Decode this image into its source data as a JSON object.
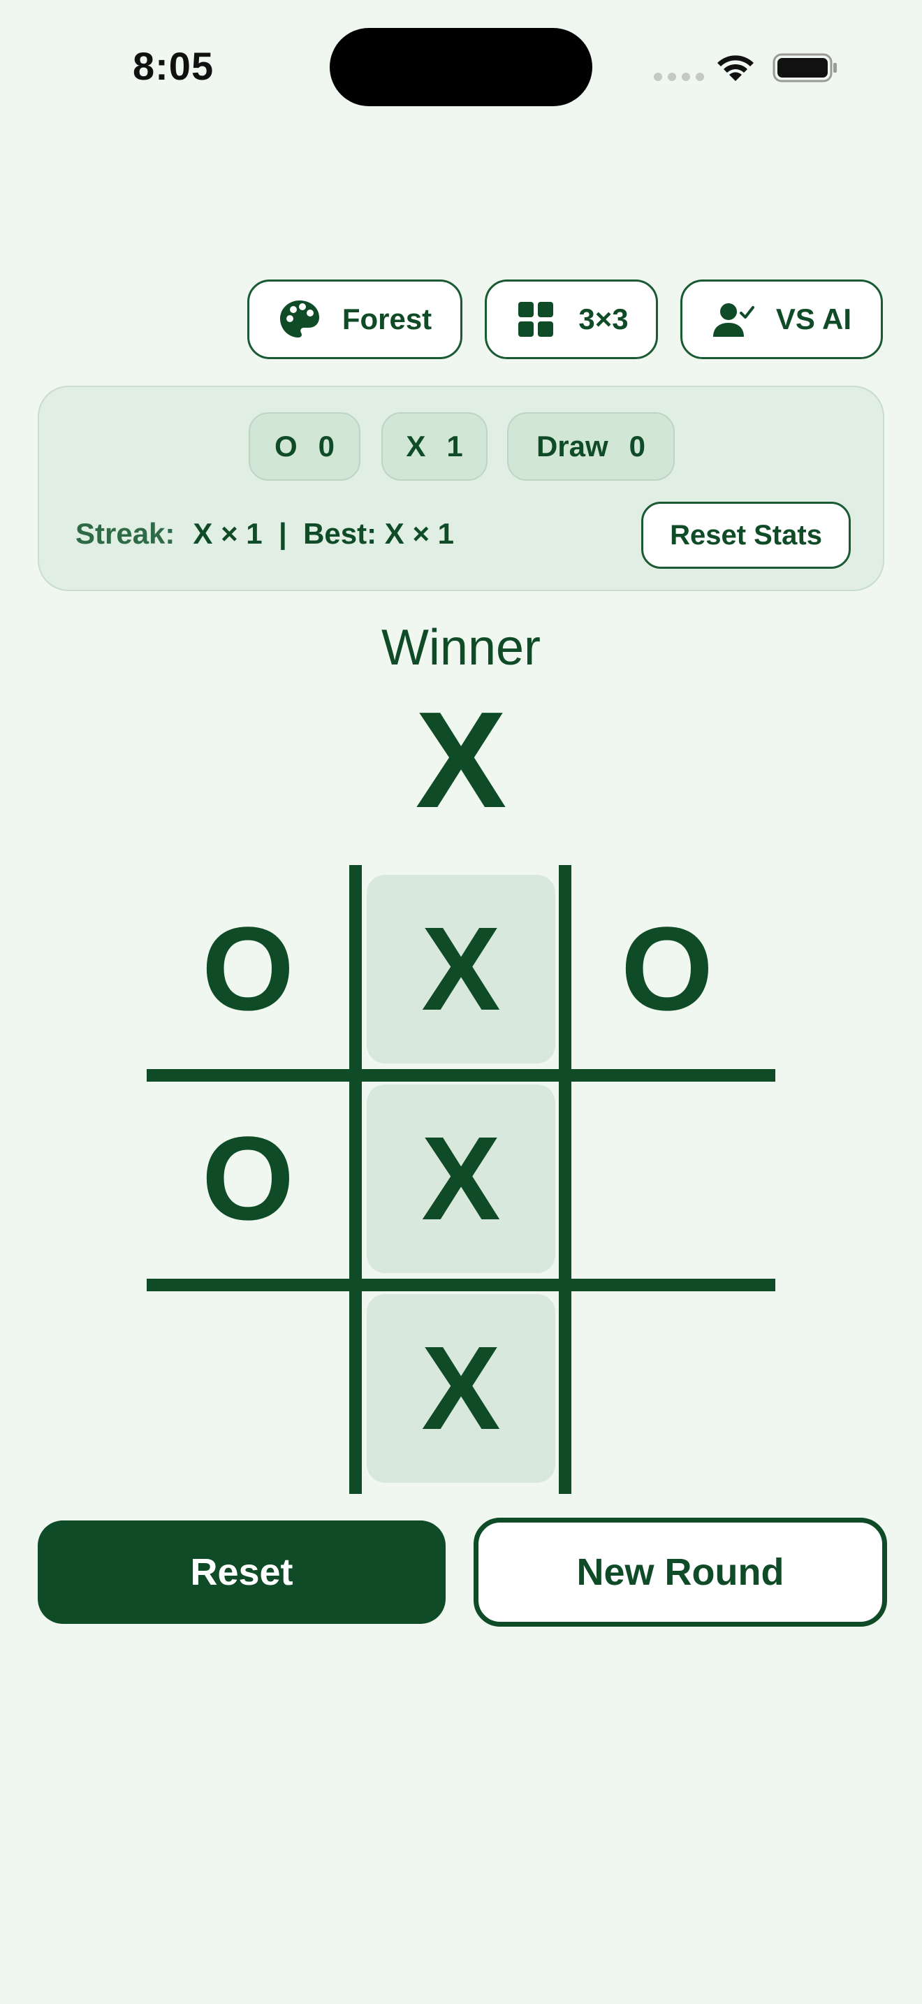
{
  "status_bar": {
    "time": "8:05"
  },
  "toolbar": {
    "theme_label": "Forest",
    "size_label": "3×3",
    "mode_label": "VS AI"
  },
  "stats": {
    "o_label": "O",
    "o_count": "0",
    "x_label": "X",
    "x_count": "1",
    "draw_label": "Draw",
    "draw_count": "0",
    "streak_label": "Streak:",
    "streak_value": "X × 1  |  Best: X × 1",
    "reset_stats_label": "Reset Stats"
  },
  "result": {
    "label": "Winner",
    "mark": "X"
  },
  "board": {
    "cells": [
      "O",
      "X",
      "O",
      "O",
      "X",
      "",
      "",
      "X",
      ""
    ],
    "winning_cells": [
      1,
      4,
      7
    ]
  },
  "actions": {
    "reset_label": "Reset",
    "new_round_label": "New Round"
  },
  "colors": {
    "accent": "#0e4b26",
    "background": "#eff7f0",
    "panel": "#e0eee3",
    "highlight": "#d9e8dd"
  },
  "icons": {
    "theme": "palette-icon",
    "size": "grid-icon",
    "mode": "person-check-icon"
  }
}
